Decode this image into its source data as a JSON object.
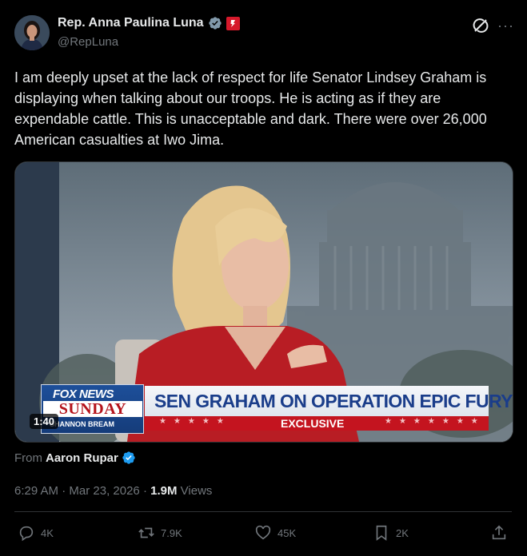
{
  "author": {
    "display_name": "Rep. Anna Paulina Luna",
    "handle": "@RepLuna"
  },
  "tweet": {
    "text": "I am deeply upset at the lack of respect for life Senator Lindsey Graham is displaying when talking about our troops. He is acting as if they are expendable cattle. This is unacceptable and dark. There were over 26,000 American casualties at Iwo Jima."
  },
  "media": {
    "logo_network": "FOX NEWS",
    "logo_show": "SUNDAY",
    "logo_host": "SHANNON BREAM",
    "headline": "SEN GRAHAM ON OPERATION EPIC FURY",
    "tag": "EXCLUSIVE",
    "duration": "1:40"
  },
  "source": {
    "prefix": "From",
    "name": "Aaron Rupar"
  },
  "meta": {
    "time": "6:29 AM",
    "separator": "·",
    "date": "Mar 23, 2026",
    "views_count": "1.9M",
    "views_label": "Views"
  },
  "actions": {
    "replies": "4K",
    "reposts": "7.9K",
    "likes": "45K",
    "bookmarks": "2K"
  },
  "colors": {
    "background": "#000000",
    "text": "#e7e9ea",
    "secondary": "#71767b",
    "verified": "#1d9bf0",
    "fox_blue": "#1a3d8a",
    "fox_red": "#c4141f"
  },
  "icons": [
    "verified-badge-icon",
    "affiliation-badge-icon",
    "grok-icon",
    "more-icon",
    "reply-icon",
    "repost-icon",
    "like-icon",
    "bookmark-icon",
    "share-icon"
  ]
}
